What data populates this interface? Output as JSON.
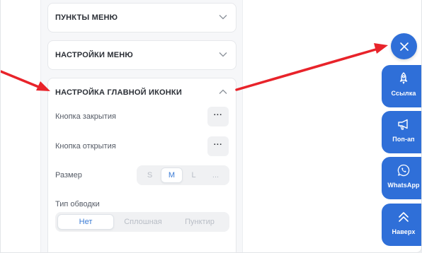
{
  "panel": {
    "sections": [
      {
        "title": "ПУНКТЫ МЕНЮ",
        "expanded": false
      },
      {
        "title": "НАСТРОЙКИ МЕНЮ",
        "expanded": false
      },
      {
        "title": "НАСТРОЙКА ГЛАВНОЙ ИКОНКИ",
        "expanded": true
      }
    ],
    "close_button_label": "Кнопка закрытия",
    "open_button_label": "Кнопка открытия",
    "dots": "···",
    "size": {
      "label": "Размер",
      "options": [
        "S",
        "M",
        "L",
        "..."
      ],
      "selected": "M"
    },
    "stroke": {
      "label": "Тип обводки",
      "options": [
        "Нет",
        "Сплошная",
        "Пунктир"
      ],
      "selected": "Нет"
    }
  },
  "widget": {
    "close_icon": "close-icon",
    "buttons": [
      {
        "label": "Ссылка",
        "icon": "rocket-icon"
      },
      {
        "label": "Поп-ап",
        "icon": "megaphone-icon"
      },
      {
        "label": "WhatsApp",
        "icon": "whatsapp-icon"
      },
      {
        "label": "Наверх",
        "icon": "double-chevron-up-icon"
      }
    ]
  },
  "colors": {
    "accent": "#2f6fd8",
    "arrow": "#e8232a",
    "active_text": "#3a7bd5"
  }
}
